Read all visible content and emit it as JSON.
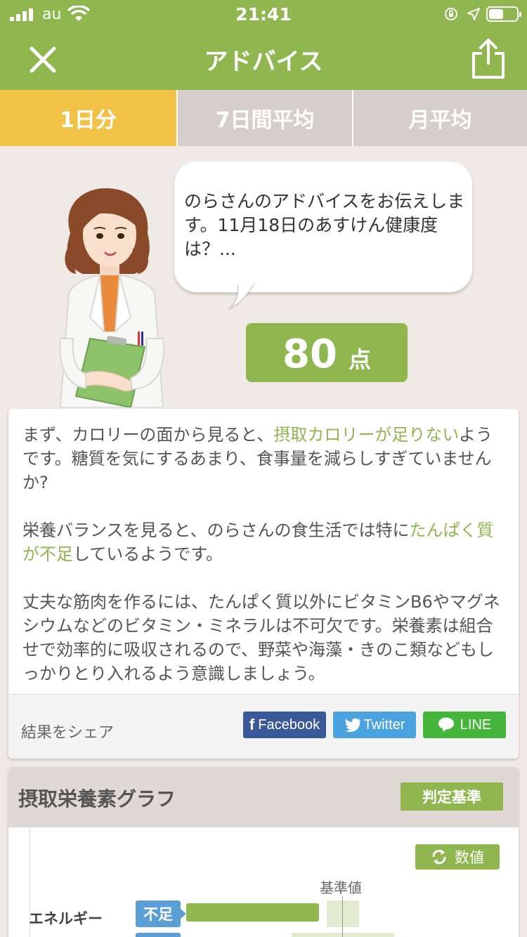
{
  "status_bar": {
    "carrier": "au",
    "time": "21:41",
    "icons": [
      "signal-icon",
      "wifi-icon",
      "orientation-lock-icon",
      "location-icon",
      "battery-icon"
    ]
  },
  "nav": {
    "title": "アドバイス",
    "close_icon": "close-icon",
    "share_icon": "share-icon"
  },
  "tabs": [
    {
      "label": "1日分",
      "active": true
    },
    {
      "label": "7日間平均",
      "active": false
    },
    {
      "label": "月平均",
      "active": false
    }
  ],
  "speech": {
    "text": "のらさんのアドバイスをお伝えします。11月18日のあすけん健康度は？..."
  },
  "score": {
    "value": "80",
    "unit": "点"
  },
  "advice": {
    "p1_a": "まず、カロリーの面から見ると、",
    "p1_hl": "摂取カロリーが足りない",
    "p1_b": "ようです。糖質を気にするあまり、食事量を減らしすぎていませんか?",
    "p2_a": "栄養バランスを見ると、のらさんの食生活では特に",
    "p2_hl": "たんぱく質が不足",
    "p2_b": "しているようです。",
    "p3": "丈夫な筋肉を作るには、たんぱく質以外にビタミンB6やマグネシウムなどのビタミン・ミネラルは不可欠です。栄養素は組合せで効率的に吸収されるので、野菜や海藻・きのこ類などもしっかりとり入れるよう意識しましょう。"
  },
  "share": {
    "label": "結果をシェア",
    "facebook": "Facebook",
    "twitter": "Twitter",
    "line": "LINE"
  },
  "graph": {
    "title": "摂取栄養素グラフ",
    "criteria_button": "判定基準",
    "values_button": "数値",
    "reference_label": "基準値",
    "rows": [
      {
        "name": "エネルギー",
        "status": "不足",
        "level": 0.85
      }
    ]
  },
  "colors": {
    "brand_green": "#8fb64f",
    "tab_active": "#f2c246",
    "tab_inactive": "#d6ceca",
    "deficit_blue": "#5c9fd6",
    "facebook": "#3b5998",
    "twitter": "#4aa3df",
    "line": "#44b43a"
  }
}
